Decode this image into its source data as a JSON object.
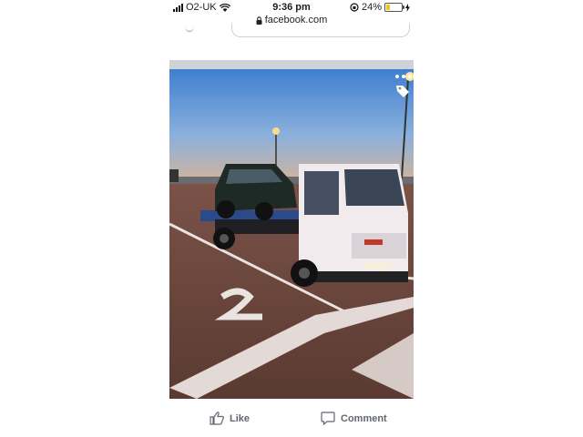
{
  "status_bar": {
    "carrier": "O2-UK",
    "time": "9:36 pm",
    "battery": "24%",
    "battery_level": 0.24
  },
  "browser": {
    "url": "facebook.com"
  },
  "post": {
    "image_icons": [
      "tag-icon",
      "more-options-icon"
    ],
    "actions": {
      "like": "Like",
      "comment": "Comment"
    }
  }
}
